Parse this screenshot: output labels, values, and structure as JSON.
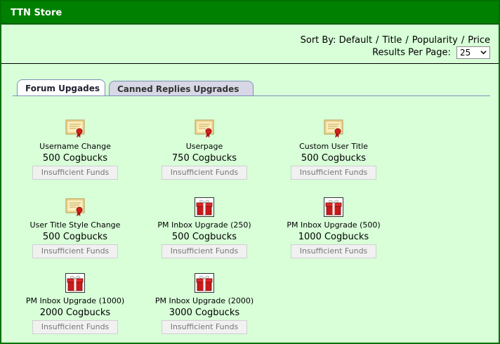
{
  "window": {
    "title": "TTN Store"
  },
  "sort": {
    "label": "Sort By:",
    "options": [
      "Default",
      "Title",
      "Popularity",
      "Price"
    ],
    "separator": "/"
  },
  "results": {
    "label": "Results Per Page:",
    "value": "25"
  },
  "tabs": [
    {
      "label": "Forum Upgades",
      "active": true
    },
    {
      "label": "Canned Replies Upgrades",
      "active": false
    }
  ],
  "items": [
    {
      "name": "Username Change",
      "price": "500 Cogbucks",
      "button": "Insufficient Funds",
      "icon": "certificate-icon"
    },
    {
      "name": "Userpage",
      "price": "750 Cogbucks",
      "button": "Insufficient Funds",
      "icon": "certificate-icon"
    },
    {
      "name": "Custom User Title",
      "price": "500 Cogbucks",
      "button": "Insufficient Funds",
      "icon": "certificate-icon"
    },
    {
      "name": "User Title Style Change",
      "price": "500 Cogbucks",
      "button": "Insufficient Funds",
      "icon": "certificate-icon"
    },
    {
      "name": "PM Inbox Upgrade (250)",
      "price": "500 Cogbucks",
      "button": "Insufficient Funds",
      "icon": "gift-icon"
    },
    {
      "name": "PM Inbox Upgrade (500)",
      "price": "1000 Cogbucks",
      "button": "Insufficient Funds",
      "icon": "gift-icon"
    },
    {
      "name": "PM Inbox Upgrade (1000)",
      "price": "2000 Cogbucks",
      "button": "Insufficient Funds",
      "icon": "gift-icon"
    },
    {
      "name": "PM Inbox Upgrade (2000)",
      "price": "3000 Cogbucks",
      "button": "Insufficient Funds",
      "icon": "gift-icon"
    }
  ],
  "colors": {
    "header": "#008000",
    "background": "#d8ffd8",
    "tab_border": "#7e8fbb"
  }
}
